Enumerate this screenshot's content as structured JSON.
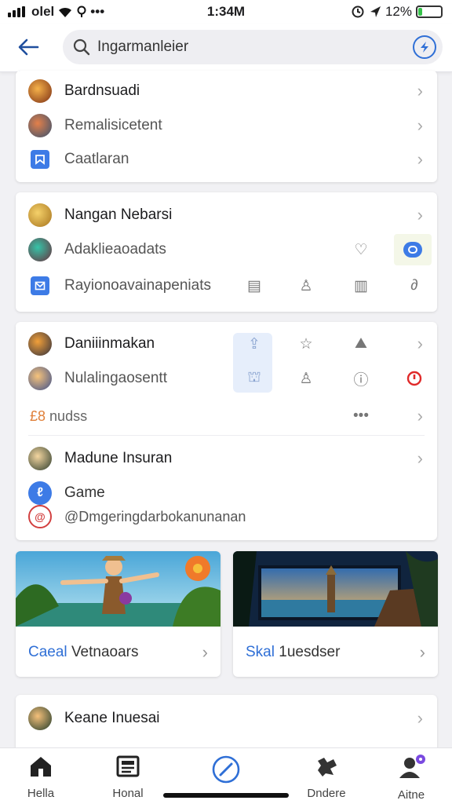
{
  "status": {
    "carrier": "olel",
    "time": "1:34M",
    "battery": "12%",
    "battery_level": 0.12
  },
  "search": {
    "query": "Ingarmanleier"
  },
  "colors": {
    "accent": "#2f6fd6",
    "battery": "#36c24a",
    "alert": "#e02a2a"
  },
  "card1": {
    "rows": [
      {
        "label": "Bardnsuadi",
        "icon": "game-avatar"
      },
      {
        "label": "Remalisicetent",
        "icon": "game-avatar"
      },
      {
        "label": "Caatlaran",
        "icon": "bookmark-icon"
      }
    ]
  },
  "card2": {
    "rows": [
      {
        "label": "Nangan Nebarsi",
        "icon": "game-avatar"
      },
      {
        "label": "Adaklieaoadats",
        "icon": "game-avatar"
      },
      {
        "label": "Rayionoavainapeniats",
        "icon": "message-icon"
      }
    ]
  },
  "card3": {
    "rows": [
      {
        "label": "Daniiinmakan"
      },
      {
        "label": "Nulalingaosentt"
      },
      {
        "prefix": "£8",
        "label": "nudss"
      },
      {
        "label": "Madune Insuran"
      },
      {
        "label": "Game"
      },
      {
        "label": "@Dmgeringdarbokanunanan"
      }
    ]
  },
  "tiles": [
    {
      "accent": "Caeal",
      "label": "Vetnaoars"
    },
    {
      "accent": "Skal",
      "label": "1uesdser"
    }
  ],
  "card4": {
    "label": "Keane Inuesai"
  },
  "nav": [
    {
      "label": "Hella",
      "icon": "home-icon"
    },
    {
      "label": "Honal",
      "icon": "news-icon"
    },
    {
      "label": "",
      "icon": "compass-icon"
    },
    {
      "label": "Dndere",
      "icon": "puzzle-icon"
    },
    {
      "label": "Aitne",
      "icon": "profile-icon"
    }
  ]
}
